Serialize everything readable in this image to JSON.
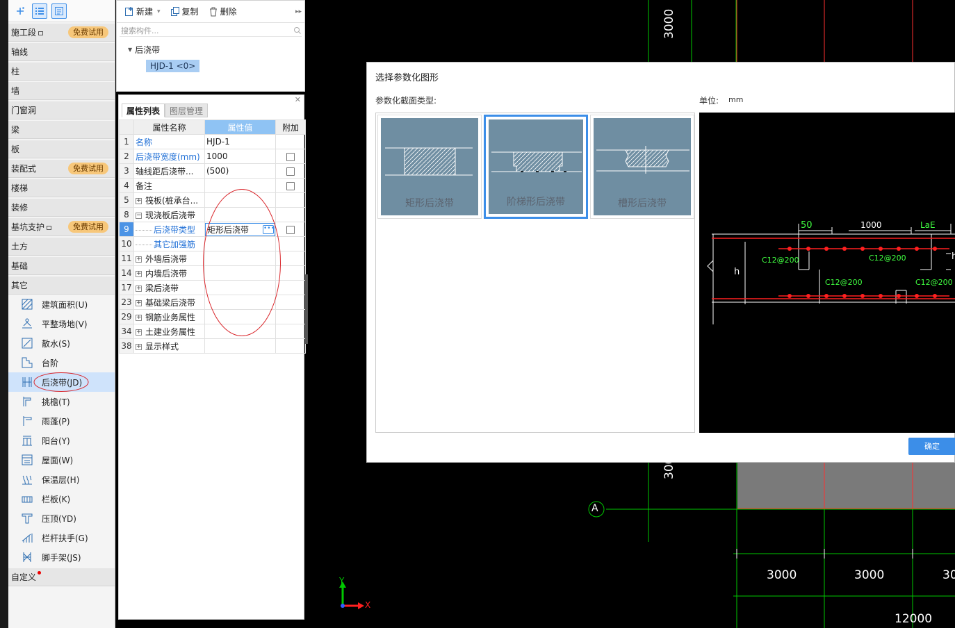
{
  "nav": {
    "toolbar": [
      {
        "icon": "sparkle-add-icon"
      },
      {
        "icon": "list-view-icon",
        "selected": true
      },
      {
        "icon": "detail-view-icon",
        "selected": true
      }
    ],
    "categories_top": [
      {
        "label": "施工段",
        "badge": "免费试用",
        "lock": true
      },
      {
        "label": "轴线"
      },
      {
        "label": "柱"
      },
      {
        "label": "墙"
      },
      {
        "label": "门窗洞"
      },
      {
        "label": "梁"
      },
      {
        "label": "板"
      },
      {
        "label": "装配式",
        "badge": "免费试用"
      },
      {
        "label": "楼梯"
      },
      {
        "label": "装修"
      },
      {
        "label": "基坑支护",
        "badge": "免费试用",
        "lock": true
      },
      {
        "label": "土方"
      },
      {
        "label": "基础"
      },
      {
        "label": "其它"
      }
    ],
    "other_items": [
      {
        "label": "建筑面积(U)",
        "icon": "building-area-icon"
      },
      {
        "label": "平整场地(V)",
        "icon": "site-leveling-icon"
      },
      {
        "label": "散水(S)",
        "icon": "apron-icon"
      },
      {
        "label": "台阶",
        "icon": "steps-icon"
      },
      {
        "label": "后浇带(JD)",
        "icon": "post-cast-strip-icon",
        "selected": true
      },
      {
        "label": "挑檐(T)",
        "icon": "cornice-icon"
      },
      {
        "label": "雨蓬(P)",
        "icon": "canopy-icon"
      },
      {
        "label": "阳台(Y)",
        "icon": "balcony-icon"
      },
      {
        "label": "屋面(W)",
        "icon": "roof-icon"
      },
      {
        "label": "保温层(H)",
        "icon": "insulation-icon"
      },
      {
        "label": "栏板(K)",
        "icon": "parapet-icon"
      },
      {
        "label": "压顶(YD)",
        "icon": "coping-icon"
      },
      {
        "label": "栏杆扶手(G)",
        "icon": "railing-icon"
      },
      {
        "label": "脚手架(JS)",
        "icon": "scaffold-icon"
      }
    ],
    "custom": {
      "label": "自定义"
    }
  },
  "components": {
    "new_label": "新建",
    "copy_label": "复制",
    "delete_label": "删除",
    "search_placeholder": "搜索构件...",
    "tree_root": "后浇带",
    "tree_item": "HJD-1 <0>"
  },
  "properties": {
    "tabs": [
      "属性列表",
      "图层管理"
    ],
    "headers": {
      "name": "属性名称",
      "value": "属性值",
      "extra": "附加"
    },
    "rows": [
      {
        "no": "1",
        "name": "名称",
        "value": "HJD-1",
        "blue": true
      },
      {
        "no": "2",
        "name": "后浇带宽度(mm)",
        "value": "1000",
        "blue": true,
        "checkbox": true
      },
      {
        "no": "3",
        "name": "轴线距后浇带...",
        "value": "(500)",
        "checkbox": true
      },
      {
        "no": "4",
        "name": "备注",
        "value": "",
        "checkbox": true
      },
      {
        "no": "5",
        "name": "筏板(桩承台...",
        "value": "",
        "expand": "+"
      },
      {
        "no": "8",
        "name": "现浇板后浇带",
        "value": "",
        "expand": "−"
      },
      {
        "no": "9",
        "name": "后浇带类型",
        "value": "矩形后浇带",
        "blue": true,
        "indent": true,
        "selected": true,
        "checkbox": true
      },
      {
        "no": "10",
        "name": "其它加强筋",
        "value": "",
        "blue": true,
        "indent": true
      },
      {
        "no": "11",
        "name": "外墙后浇带",
        "value": "",
        "expand": "+"
      },
      {
        "no": "14",
        "name": "内墙后浇带",
        "value": "",
        "expand": "+"
      },
      {
        "no": "17",
        "name": "梁后浇带",
        "value": "",
        "expand": "+"
      },
      {
        "no": "23",
        "name": "基础梁后浇带",
        "value": "",
        "expand": "+"
      },
      {
        "no": "29",
        "name": "钢筋业务属性",
        "value": "",
        "expand": "+"
      },
      {
        "no": "34",
        "name": "土建业务属性",
        "value": "",
        "expand": "+"
      },
      {
        "no": "38",
        "name": "显示样式",
        "value": "",
        "expand": "+"
      }
    ]
  },
  "dialog": {
    "title": "选择参数化图形",
    "section_label": "参数化截面类型:",
    "unit_label": "单位:",
    "unit_value": "mm",
    "shapes": [
      {
        "label": "矩形后浇带",
        "kind": "rect"
      },
      {
        "label": "阶梯形后浇带",
        "kind": "step",
        "selected": true
      },
      {
        "label": "槽形后浇带",
        "kind": "groove"
      }
    ],
    "preview": {
      "dim_50": "50",
      "dim_1000": "1000",
      "dim_lae": "LaE",
      "h_left": "h",
      "h_right": "h",
      "rebar_1": "C12@200",
      "rebar_2": "C12@200",
      "rebar_3": "C12@200",
      "rebar_4": "C12@200"
    },
    "ok_label": "确定"
  },
  "drawing": {
    "dim_top": "3000",
    "dim_mid": "300",
    "axis_a": "A",
    "dim_b1": "3000",
    "dim_b2": "3000",
    "dim_b3": "30",
    "dim_total": "12000",
    "axis_y": "Y",
    "axis_x": "X"
  },
  "colors": {
    "accent": "#3c8ee8",
    "grid_green": "#00c800",
    "rebar_red": "#ff2020",
    "badge": "#f7c77a"
  }
}
